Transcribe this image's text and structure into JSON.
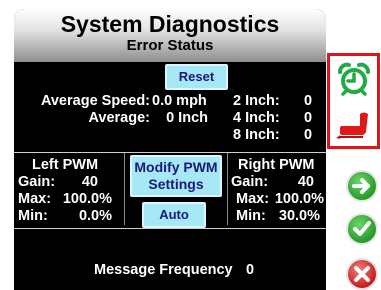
{
  "header": {
    "title": "System Diagnostics",
    "subtitle": "Error Status",
    "reset_label": "Reset"
  },
  "speeds": {
    "average_speed_label": "Average Speed:",
    "average_speed_value": "0.0 mph",
    "average_label": "Average:",
    "average_value": "0 Inch",
    "inch2_label": "2 Inch:",
    "inch2_value": "0",
    "inch4_label": "4 Inch:",
    "inch4_value": "0",
    "inch8_label": "8 Inch:",
    "inch8_value": "0"
  },
  "left_pwm": {
    "title": "Left PWM",
    "gain_label": "Gain:",
    "gain_value": "40",
    "max_label": "Max:",
    "max_value": "100.0%",
    "min_label": "Min:",
    "min_value": "0.0%"
  },
  "right_pwm": {
    "title": "Right PWM",
    "gain_label": "Gain:",
    "gain_value": "40",
    "max_label": "Max:",
    "max_value": "100.0%",
    "min_label": "Min:",
    "min_value": "30.0%"
  },
  "center": {
    "modify_line1": "Modify PWM",
    "modify_line2": "Settings",
    "auto_label": "Auto"
  },
  "footer": {
    "message_frequency_label": "Message Frequency",
    "message_frequency_value": "0"
  },
  "icons": {
    "status_alarm": "alarm-clock-icon",
    "status_seat": "seat-icon",
    "next": "arrow-right-icon",
    "accept": "checkmark-icon",
    "cancel": "x-icon"
  },
  "colors": {
    "highlight_box": "#e0141a",
    "button_cyan": "#a6e8f6",
    "alarm_green": "#22aa44",
    "seat_red": "#e01818"
  }
}
